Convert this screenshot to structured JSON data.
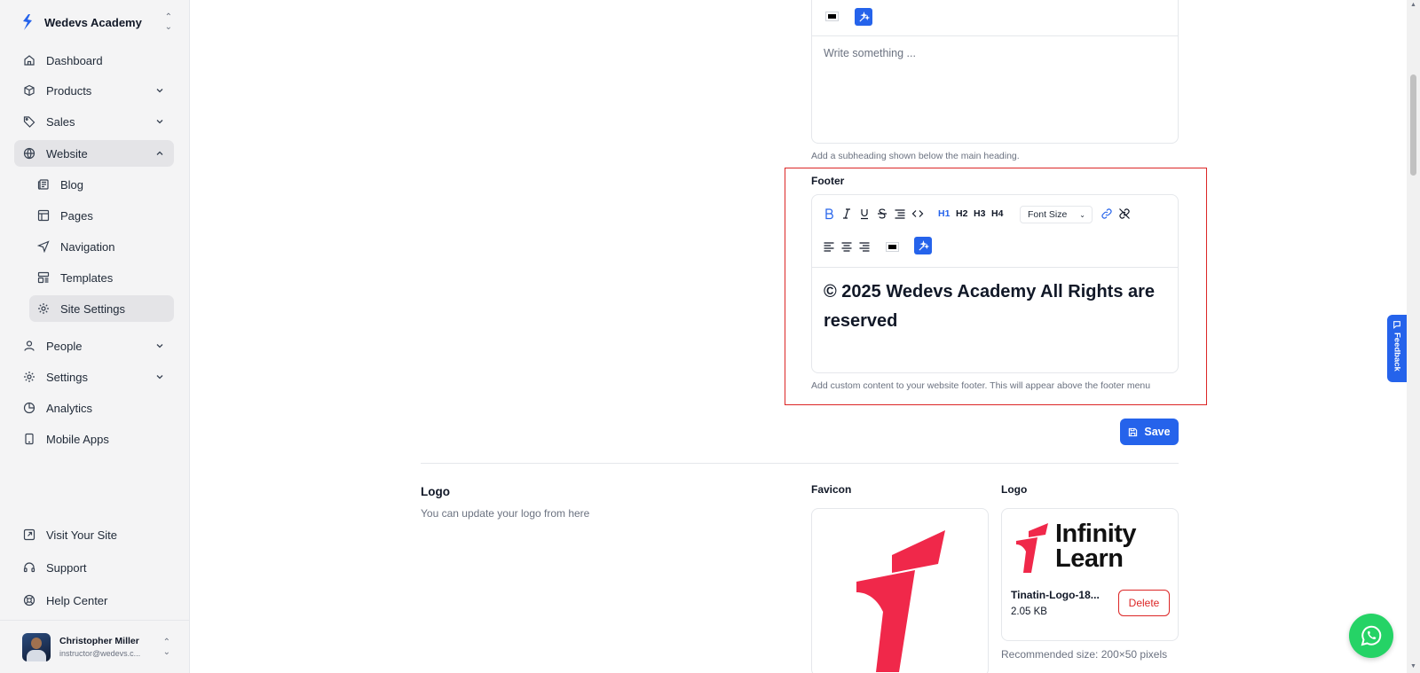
{
  "brand": {
    "name": "Wedevs Academy"
  },
  "sidebar": {
    "items": [
      {
        "label": "Dashboard"
      },
      {
        "label": "Products"
      },
      {
        "label": "Sales"
      },
      {
        "label": "Website"
      },
      {
        "label": "Blog"
      },
      {
        "label": "Pages"
      },
      {
        "label": "Navigation"
      },
      {
        "label": "Templates"
      },
      {
        "label": "Site Settings"
      },
      {
        "label": "People"
      },
      {
        "label": "Settings"
      },
      {
        "label": "Analytics"
      },
      {
        "label": "Mobile Apps"
      }
    ],
    "bottom": [
      {
        "label": "Visit Your Site"
      },
      {
        "label": "Support"
      },
      {
        "label": "Help Center"
      }
    ]
  },
  "user": {
    "name": "Christopher Miller",
    "email": "instructor@wedevs.c..."
  },
  "subheading_editor": {
    "placeholder": "Write something ...",
    "help": "Add a subheading shown below the main heading."
  },
  "footer_editor": {
    "label": "Footer",
    "font_size_label": "Font Size",
    "content": "© 2025 Wedevs Academy All Rights are reserved",
    "help": "Add custom content to your website footer. This will appear above the footer menu",
    "toolbar": {
      "h1": "H1",
      "h2": "H2",
      "h3": "H3",
      "h4": "H4"
    }
  },
  "actions": {
    "save_label": "Save"
  },
  "logo_section": {
    "title": "Logo",
    "description": "You can update your logo from here",
    "favicon_label": "Favicon",
    "logo_label": "Logo",
    "logo_text": [
      "Infinity",
      "Learn"
    ],
    "file_name": "Tinatin-Logo-18...",
    "file_size": "2.05 KB",
    "delete_label": "Delete",
    "recommended": "Recommended size: 200×50 pixels"
  },
  "feedback": {
    "label": "Feedback"
  },
  "colors": {
    "accent": "#2563eb",
    "danger": "#dc2626",
    "brand_red": "#f0284a",
    "whatsapp": "#25d366"
  }
}
